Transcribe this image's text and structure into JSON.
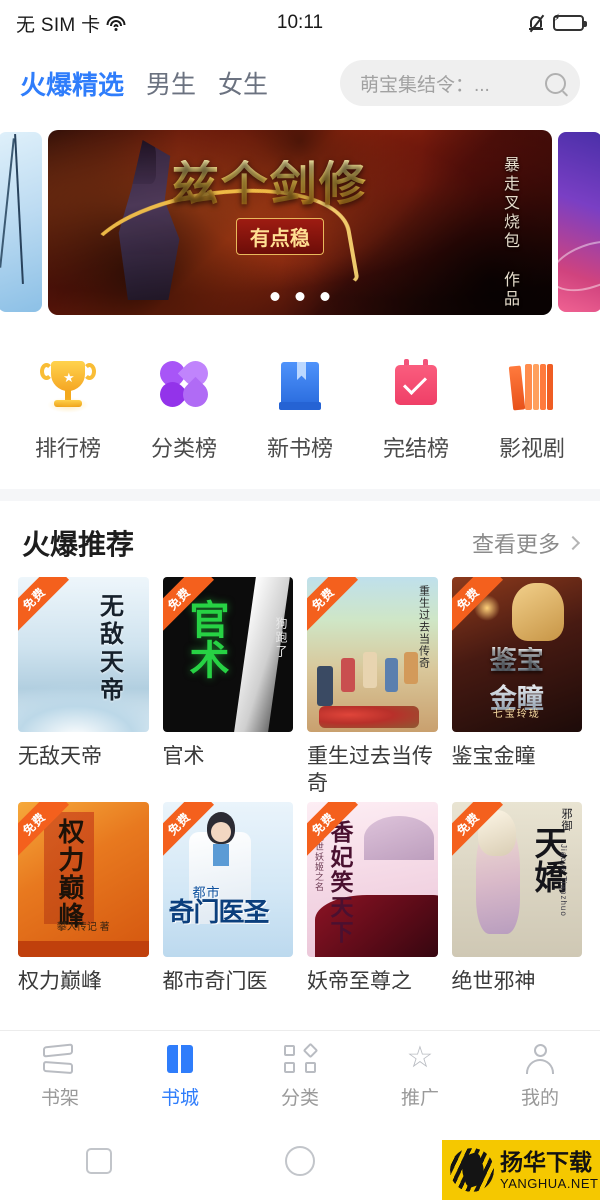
{
  "status_bar": {
    "carrier": "无 SIM 卡",
    "wifi_icon": "wifi-icon",
    "time": "10:11",
    "mute_icon": "bell-mute-icon",
    "battery_icon": "battery-charging-icon"
  },
  "top_nav": {
    "tabs": [
      {
        "label": "火爆精选",
        "active": true
      },
      {
        "label": "男生",
        "active": false
      },
      {
        "label": "女生",
        "active": false
      }
    ],
    "search": {
      "placeholder": "萌宝集结令：...",
      "icon": "search-icon"
    },
    "active_color": "#2f7dfb"
  },
  "banner": {
    "title": "兹个剑修",
    "subtitle": "有点稳",
    "author": "暴走叉烧包 作品",
    "dots": 3,
    "active_dot": 0
  },
  "quick_entries": [
    {
      "label": "排行榜",
      "icon": "trophy-icon",
      "color": "#f5a623"
    },
    {
      "label": "分类榜",
      "icon": "clover-icon",
      "color": "#a855f7"
    },
    {
      "label": "新书榜",
      "icon": "book-icon",
      "color": "#2f7dfb"
    },
    {
      "label": "完结榜",
      "icon": "calendar-check-icon",
      "color": "#ef3f67"
    },
    {
      "label": "影视剧",
      "icon": "books-stack-icon",
      "color": "#f4601d"
    }
  ],
  "section": {
    "title": "火爆推荐",
    "more_label": "查看更多",
    "more_icon": "chevron-right-icon"
  },
  "books": [
    {
      "title": "无敌天帝",
      "badge": "免费",
      "cover_title": "无敌天帝",
      "cover_style": "cv-1"
    },
    {
      "title": "官术",
      "badge": "免费",
      "cover_title": "官术",
      "cover_author": "狗跑了",
      "cover_style": "cv-2"
    },
    {
      "title": "重生过去当传奇",
      "badge": "免费",
      "cover_title": "重生过去当传奇",
      "cover_style": "cv-3"
    },
    {
      "title": "鉴宝金瞳",
      "badge": "免费",
      "cover_title": "鉴宝",
      "cover_title2": "金瞳",
      "cover_sub": "七宝玲珑",
      "cover_style": "cv-4"
    },
    {
      "title": "权力巅峰",
      "badge": "免费",
      "cover_title": "权力巅峰",
      "cover_author": "攀人传记 著",
      "cover_style": "cv-5"
    },
    {
      "title": "都市奇门医",
      "badge": "免费",
      "cover_title": "奇门医圣",
      "cover_sub": "都市",
      "cover_style": "cv-6"
    },
    {
      "title": "妖帝至尊之",
      "badge": "免费",
      "cover_title": "香妃笑天下",
      "cover_sub": "绝世妖姬之名",
      "cover_style": "cv-7"
    },
    {
      "title": "绝世邪神",
      "badge": "免费",
      "cover_title": "天嬌",
      "cover_tag": "邪御",
      "cover_en": "Jiaoye Tianzhuo",
      "cover_style": "cv-8"
    }
  ],
  "bottom_nav": [
    {
      "label": "书架",
      "icon": "bookshelf-icon",
      "active": false
    },
    {
      "label": "书城",
      "icon": "bookstore-icon",
      "active": true
    },
    {
      "label": "分类",
      "icon": "categories-icon",
      "active": false
    },
    {
      "label": "推广",
      "icon": "star-icon",
      "active": false
    },
    {
      "label": "我的",
      "icon": "person-icon",
      "active": false
    }
  ],
  "android_nav": {
    "recents_icon": "square-icon",
    "home_icon": "circle-icon",
    "back_icon": "triangle-back-icon"
  },
  "watermark": {
    "cn": "扬华下载",
    "en": "YANGHUA.NET",
    "logo_icon": "yanghua-logo-icon",
    "background": "#f5c800"
  }
}
